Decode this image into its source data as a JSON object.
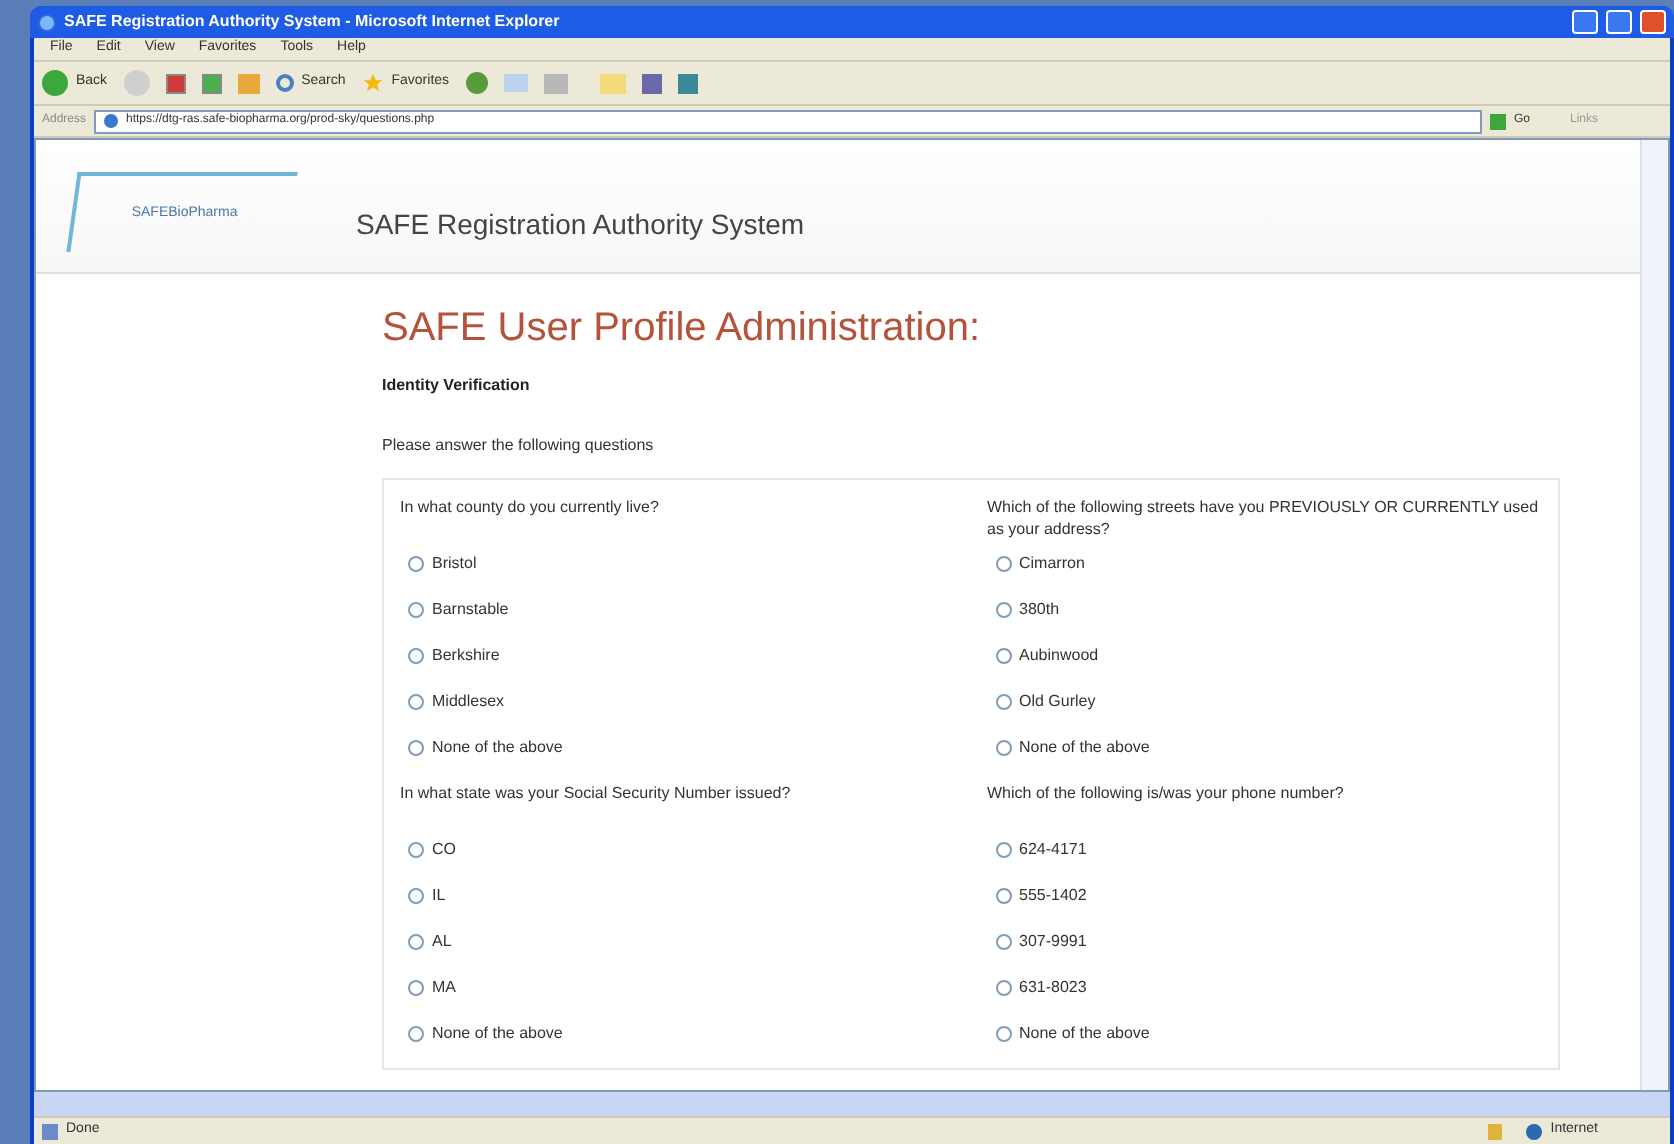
{
  "window": {
    "title": "SAFE Registration Authority System - Microsoft Internet Explorer"
  },
  "menu": [
    "File",
    "Edit",
    "View",
    "Favorites",
    "Tools",
    "Help"
  ],
  "toolbar": {
    "back": "Back",
    "search": "Search",
    "favorites": "Favorites"
  },
  "address_bar": {
    "label": "Address",
    "url": "https://dtg-ras.safe-biopharma.org/prod-sky/questions.php",
    "go": "Go",
    "links": "Links"
  },
  "page": {
    "logo": "SAFEBioPharma",
    "site_title": "SAFE Registration Authority System",
    "heading": "SAFE User Profile Administration:",
    "section": "Identity Verification",
    "instructions": "Please answer the following questions",
    "questions": [
      {
        "text": "In what county do you currently live?",
        "options": [
          {
            "label": "Bristol",
            "selected": false
          },
          {
            "label": "Barnstable",
            "selected": false
          },
          {
            "label": "Berkshire",
            "selected": false
          },
          {
            "label": "Middlesex",
            "selected": false
          },
          {
            "label": "None of the above",
            "selected": false
          }
        ]
      },
      {
        "text": "Which of the following streets have you PREVIOUSLY OR CURRENTLY used as your address?",
        "options": [
          {
            "label": "Cimarron",
            "selected": false
          },
          {
            "label": "380th",
            "selected": false
          },
          {
            "label": "Aubinwood",
            "selected": false
          },
          {
            "label": "Old Gurley",
            "selected": false
          },
          {
            "label": "None of the above",
            "selected": false
          }
        ]
      },
      {
        "text": "In what state was your Social Security Number issued?",
        "options": [
          {
            "label": "CO",
            "selected": false
          },
          {
            "label": "IL",
            "selected": false
          },
          {
            "label": "AL",
            "selected": false
          },
          {
            "label": "MA",
            "selected": false
          },
          {
            "label": "None of the above",
            "selected": false
          }
        ]
      },
      {
        "text": "Which of the following is/was your phone number?",
        "options": [
          {
            "label": "624-4171",
            "selected": false
          },
          {
            "label": "555-1402",
            "selected": false
          },
          {
            "label": "307-9991",
            "selected": false
          },
          {
            "label": "631-8023",
            "selected": false
          },
          {
            "label": "None of the above",
            "selected": false
          }
        ]
      }
    ]
  },
  "status_bar": {
    "status": "Done",
    "zone": "Internet"
  }
}
